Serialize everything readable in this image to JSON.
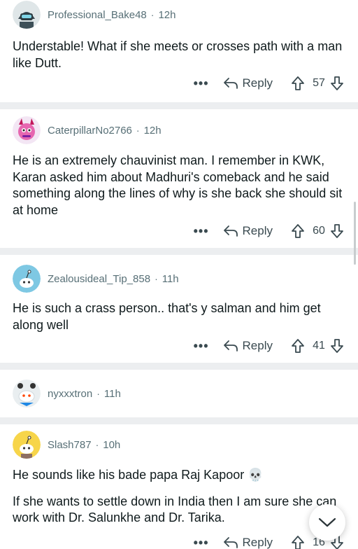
{
  "comments": [
    {
      "author": "Professional_Bake48",
      "time": "12h",
      "avatar": "robot-avatar-icon",
      "body": [
        "Understable! What if she meets or crosses path with a man like Dutt."
      ],
      "score": "57",
      "reply_label": "Reply"
    },
    {
      "author": "CaterpillarNo2766",
      "time": "12h",
      "avatar": "pink-horned-avatar-icon",
      "body": [
        "He is an extremely chauvinist man. I remember in KWK, Karan asked him about Madhuri's comeback and he said something along the lines of why is she back she should sit at home"
      ],
      "score": "60",
      "reply_label": "Reply"
    },
    {
      "author": "Zealousideal_Tip_858",
      "time": "11h",
      "avatar": "snoo-teal-avatar-icon",
      "body": [
        "He is such a crass person.. that's y salman and him get along well"
      ],
      "score": "41",
      "reply_label": "Reply"
    },
    {
      "author": "nyxxxtron",
      "time": "11h",
      "avatar": "snoo-white-avatar-icon",
      "body": [],
      "score": "",
      "reply_label": ""
    },
    {
      "author": "Slash787",
      "time": "10h",
      "avatar": "snoo-yellow-avatar-icon",
      "body": [
        "He sounds like his bade papa Raj Kapoor 💀",
        "If she wants to settle down in India then I am sure she can work with Dr. Salunkhe and Dr. Tarika."
      ],
      "score": "16",
      "reply_label": "Reply"
    }
  ],
  "separator": "·",
  "colors": {
    "meta": "#576f76",
    "text": "#0f1a1c",
    "separator": "#eceef0"
  }
}
